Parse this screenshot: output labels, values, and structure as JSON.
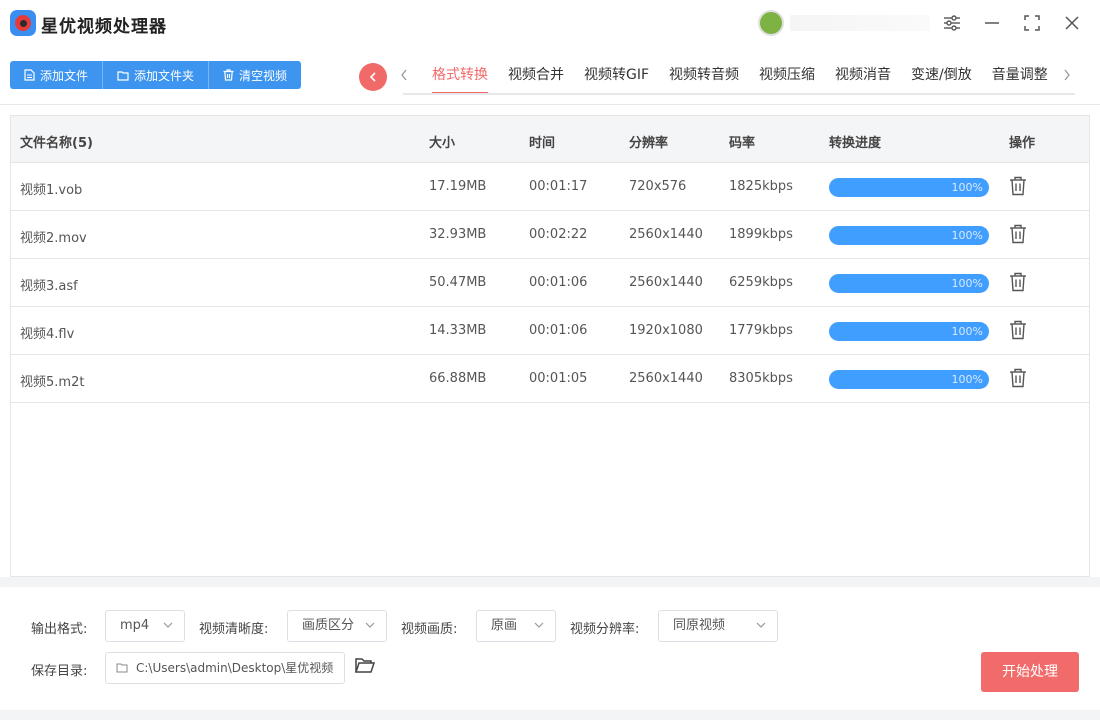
{
  "app": {
    "title": "星优视频处理器"
  },
  "toolbar": {
    "add_file": "添加文件",
    "add_folder": "添加文件夹",
    "clear": "清空视频"
  },
  "tabs": [
    "格式转换",
    "视频合并",
    "视频转GIF",
    "视频转音频",
    "视频压缩",
    "视频消音",
    "变速/倒放",
    "音量调整"
  ],
  "table": {
    "headers": {
      "name": "文件名称(5)",
      "size": "大小",
      "time": "时间",
      "resolution": "分辨率",
      "bitrate": "码率",
      "progress": "转换进度",
      "action": "操作"
    },
    "rows": [
      {
        "name": "视频1.vob",
        "size": "17.19MB",
        "time": "00:01:17",
        "resolution": "720x576",
        "bitrate": "1825kbps",
        "progress": "100%"
      },
      {
        "name": "视频2.mov",
        "size": "32.93MB",
        "time": "00:02:22",
        "resolution": "2560x1440",
        "bitrate": "1899kbps",
        "progress": "100%"
      },
      {
        "name": "视频3.asf",
        "size": "50.47MB",
        "time": "00:01:06",
        "resolution": "2560x1440",
        "bitrate": "6259kbps",
        "progress": "100%"
      },
      {
        "name": "视频4.flv",
        "size": "14.33MB",
        "time": "00:01:06",
        "resolution": "1920x1080",
        "bitrate": "1779kbps",
        "progress": "100%"
      },
      {
        "name": "视频5.m2t",
        "size": "66.88MB",
        "time": "00:01:05",
        "resolution": "2560x1440",
        "bitrate": "8305kbps",
        "progress": "100%"
      }
    ]
  },
  "settings": {
    "format_label": "输出格式:",
    "format_value": "mp4",
    "clarity_label": "视频清晰度:",
    "clarity_value": "画质区分",
    "quality_label": "视频画质:",
    "quality_value": "原画",
    "resolution_label": "视频分辨率:",
    "resolution_value": "同原视频",
    "save_label": "保存目录:",
    "save_path": "C:\\Users\\admin\\Desktop\\星优视频"
  },
  "start_button": "开始处理",
  "colors": {
    "primary_blue": "#3d95f0",
    "accent_red": "#f06a6a",
    "progress_blue": "#409eff"
  }
}
